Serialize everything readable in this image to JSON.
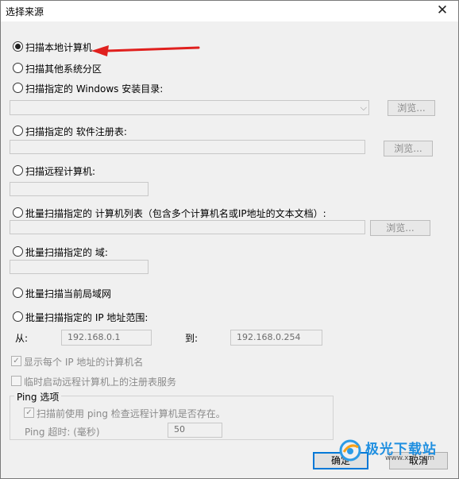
{
  "window": {
    "title": "选择来源",
    "close_glyph": "✕"
  },
  "options": {
    "scan_local": "扫描本地计算机",
    "scan_other_partition": "扫描其他系统分区",
    "scan_windows_dir": "扫描指定的 Windows 安装目录:",
    "scan_registry": "扫描指定的 软件注册表:",
    "scan_remote": "扫描远程计算机:",
    "batch_list": "批量扫描指定的 计算机列表（包含多个计算机名或IP地址的文本文档）:",
    "batch_domain": "批量扫描指定的 域:",
    "batch_lan": "批量扫描当前局域网",
    "batch_ip_range": "批量扫描指定的 IP 地址范围:"
  },
  "browse_label": "浏览...",
  "ip_range": {
    "from_label": "从:",
    "from_value": "192.168.0.1",
    "to_label": "到:",
    "to_value": "192.168.0.254"
  },
  "checkboxes": {
    "show_names": "显示每个 IP 地址的计算机名",
    "start_remote_registry": "临时启动远程计算机上的注册表服务"
  },
  "ping": {
    "group_title": "Ping 选项",
    "check_label": "扫描前使用 ping 检查远程计算机是否存在。",
    "timeout_label": "Ping 超时: (毫秒)",
    "timeout_value": "50"
  },
  "buttons": {
    "ok": "确定",
    "cancel": "取消"
  },
  "watermark": {
    "text": "极光下载站",
    "url": "www.xz7.com"
  },
  "colors": {
    "arrow": "#e0201e",
    "accent": "#0078d7"
  }
}
